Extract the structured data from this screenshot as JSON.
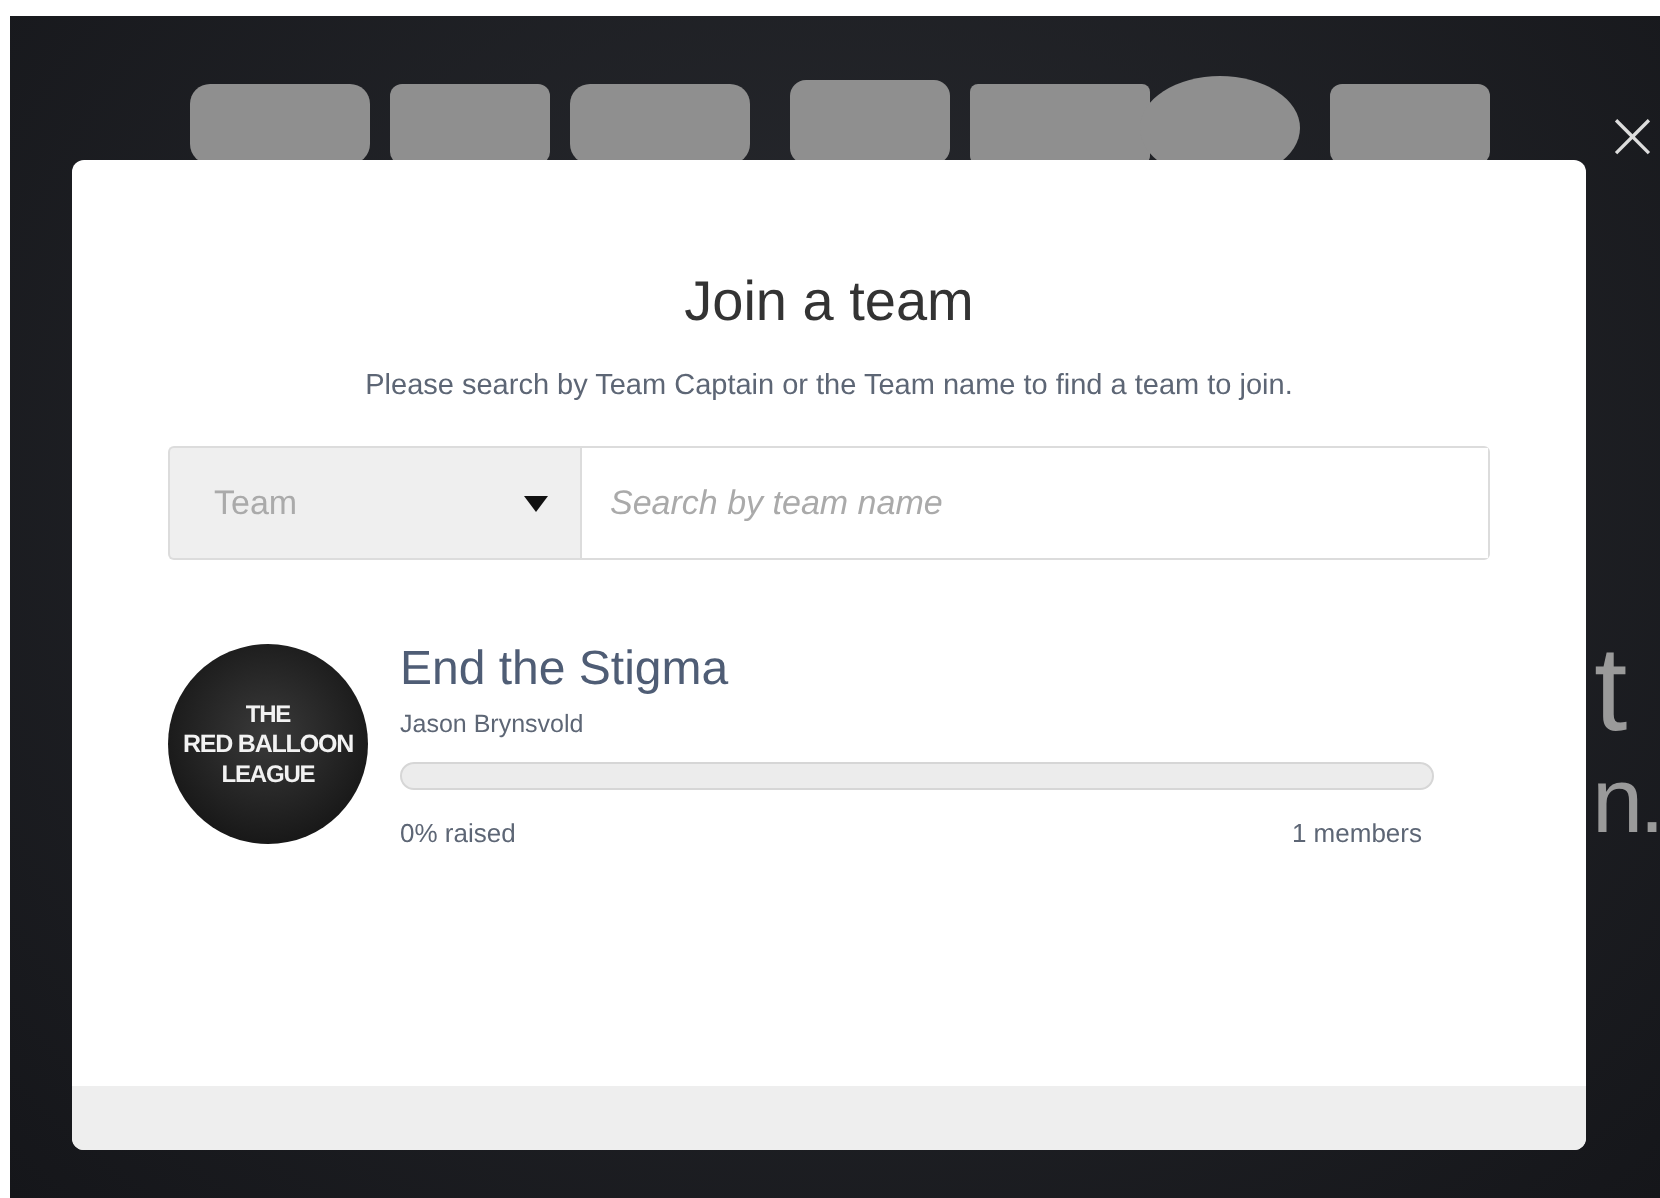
{
  "background": {
    "fragments": [
      "t",
      "n."
    ]
  },
  "modal": {
    "title": "Join a team",
    "subtitle": "Please search by Team Captain or the Team name to find a team to join.",
    "search": {
      "type_select": "Team",
      "placeholder": "Search by team name"
    },
    "teams": [
      {
        "logo_lines": [
          "THE",
          "RED BALLOON",
          "LEAGUE"
        ],
        "name": "End the Stigma",
        "captain": "Jason Brynsvold",
        "level": 0,
        "raised": "0% raised",
        "members": "1 members"
      }
    ],
    "close": "×"
  }
}
